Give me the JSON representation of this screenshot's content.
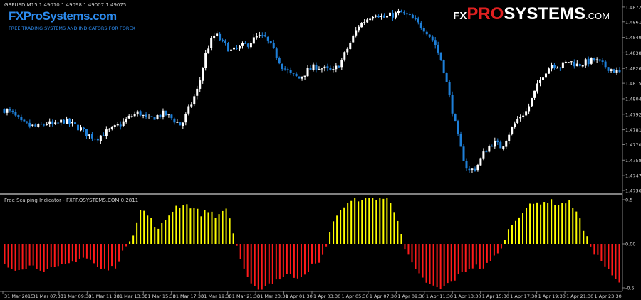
{
  "header": {
    "symbol_info": "GBPUSD,M15  1.49010 1.49098 1.49007 1.49075",
    "brand": "FXProSystems.com",
    "tagline": "FREE TRADING SYSTEMS AND INDICATORS FOR FOREX",
    "logo_prefix": "FX",
    "logo_pro": "PRO",
    "logo_systems": "SYSTEMS",
    "logo_suffix": ".COM"
  },
  "indicator": {
    "label": "Free Scalping Indicator - FXPROSYSTEMS.COM 0.2811"
  },
  "colors": {
    "background": "#000000",
    "bull_candle": "#ffffff",
    "bear_candle": "#1e7fd8",
    "positive_bar": "#ffff00",
    "negative_bar": "#ff1a1a",
    "separator": "#808080",
    "brand_blue": "#2d8cf0",
    "brand_red": "#e02020"
  },
  "chart_data": [
    {
      "type": "candlestick",
      "symbol": "GBPUSD",
      "timeframe": "M15",
      "price_ticks": [
        "1.48720",
        "1.48610",
        "1.48495",
        "1.48380",
        "1.48265",
        "1.48155",
        "1.48040",
        "1.47925",
        "1.47810",
        "1.47700",
        "1.47585",
        "1.47470",
        "1.47360"
      ],
      "ylim": [
        1.4736,
        1.4873
      ],
      "path": [
        1.4796,
        1.4793,
        1.4786,
        1.4784,
        1.4783,
        1.4786,
        1.4784,
        1.4788,
        1.4785,
        1.4782,
        1.4777,
        1.4775,
        1.4779,
        1.4782,
        1.4786,
        1.4791,
        1.4794,
        1.4788,
        1.4791,
        1.4793,
        1.4789,
        1.4784,
        1.4798,
        1.4812,
        1.484,
        1.4852,
        1.4845,
        1.4839,
        1.4842,
        1.4845,
        1.485,
        1.4849,
        1.4839,
        1.4828,
        1.4822,
        1.4819,
        1.4825,
        1.4828,
        1.4826,
        1.4824,
        1.4832,
        1.4845,
        1.4858,
        1.4863,
        1.4868,
        1.4864,
        1.4866,
        1.4868,
        1.4865,
        1.486,
        1.4855,
        1.4846,
        1.483,
        1.48,
        1.477,
        1.475,
        1.4753,
        1.4765,
        1.4772,
        1.4768,
        1.478,
        1.479,
        1.4795,
        1.481,
        1.4823,
        1.483,
        1.4828,
        1.4832,
        1.4829,
        1.4831,
        1.4833,
        1.4829,
        1.4826,
        1.4823
      ]
    },
    {
      "type": "bar",
      "name": "Free Scalping Indicator",
      "value_ticks": [
        "0.5",
        "0.00",
        "-0.5"
      ],
      "ylim": [
        -0.5,
        0.5
      ],
      "path": [
        -0.25,
        -0.28,
        -0.27,
        -0.25,
        -0.27,
        -0.3,
        -0.28,
        -0.25,
        -0.2,
        -0.15,
        -0.18,
        -0.28,
        -0.3,
        -0.25,
        -0.05,
        0.1,
        0.4,
        0.3,
        0.15,
        0.3,
        0.42,
        0.45,
        0.42,
        0.34,
        0.38,
        0.3,
        0.42,
        0.05,
        -0.3,
        -0.5,
        -0.52,
        -0.45,
        -0.4,
        -0.35,
        -0.38,
        -0.35,
        -0.25,
        -0.22,
        0.1,
        0.36,
        0.44,
        0.5,
        0.52,
        0.52,
        0.52,
        0.5,
        0.3,
        -0.05,
        -0.3,
        -0.4,
        -0.48,
        -0.52,
        -0.45,
        -0.38,
        -0.3,
        -0.25,
        -0.28,
        -0.2,
        -0.05,
        0.15,
        0.3,
        0.4,
        0.45,
        0.48,
        0.48,
        0.45,
        0.48,
        0.38,
        0.1,
        -0.08,
        -0.2,
        -0.35,
        -0.45
      ]
    }
  ],
  "time_axis": {
    "labels": [
      "31 Mar 2015",
      "31 Mar 07:30",
      "31 Mar 09:30",
      "31 Mar 11:30",
      "31 Mar 13:30",
      "31 Mar 15:30",
      "31 Mar 17:30",
      "31 Mar 19:30",
      "31 Mar 21:30",
      "31 Mar 23:30",
      "1 Apr 01:30",
      "1 Apr 03:30",
      "1 Apr 05:30",
      "1 Apr 07:30",
      "1 Apr 09:30",
      "1 Apr 11:30",
      "1 Apr 13:30",
      "1 Apr 15:30",
      "1 Apr 17:30",
      "1 Apr 19:30",
      "1 Apr 21:30",
      "1 Apr 23:30"
    ]
  }
}
